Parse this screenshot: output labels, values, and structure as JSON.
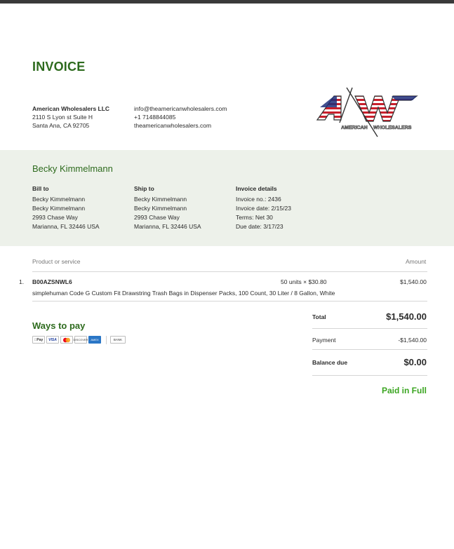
{
  "invoice": {
    "title": "INVOICE"
  },
  "company": {
    "name": "American Wholesalers LLC",
    "address_line1": "2110 S Lyon st Suite H",
    "address_line2": "Santa Ana, CA 92705",
    "email": "info@theamericanwholesalers.com",
    "phone": "+1 7148844085",
    "website": "theamericanwholesalers.com",
    "logo": {
      "letters": "AW",
      "text_left": "AMERICAN",
      "text_right": "WHOLESALERS"
    }
  },
  "customer": {
    "name": "Becky Kimmelmann",
    "bill_to": {
      "header": "Bill to",
      "lines": [
        "Becky Kimmelmann",
        "Becky Kimmelmann",
        "2993 Chase Way",
        "Marianna, FL 32446 USA"
      ]
    },
    "ship_to": {
      "header": "Ship to",
      "lines": [
        "Becky Kimmelmann",
        "Becky Kimmelmann",
        "2993 Chase Way",
        "Marianna, FL 32446 USA"
      ]
    },
    "details": {
      "header": "Invoice details",
      "lines": [
        "Invoice no.: 2436",
        "Invoice date: 2/15/23",
        "Terms: Net 30",
        "Due date: 3/17/23"
      ]
    }
  },
  "table": {
    "header_product": "Product or service",
    "header_amount": "Amount",
    "items": [
      {
        "num": "1.",
        "sku": "B00AZSNWL6",
        "qty": "50 units × $30.80",
        "amount": "$1,540.00",
        "description": "simplehuman Code G Custom Fit Drawstring Trash Bags in Dispenser Packs, 100 Count, 30 Liter / 8 Gallon, White"
      }
    ]
  },
  "payment": {
    "heading": "Ways to pay",
    "methods": [
      "Pay",
      "VISA",
      "MC",
      "DISCOVER",
      "AMEX",
      "BANK"
    ]
  },
  "summary": {
    "total_label": "Total",
    "total_value": "$1,540.00",
    "payment_label": "Payment",
    "payment_value": "-$1,540.00",
    "balance_label": "Balance due",
    "balance_value": "$0.00",
    "status": "Paid in Full"
  },
  "colors": {
    "accent": "#2e6b1e",
    "band": "#edf1ea",
    "paid": "#3aa520",
    "flag_red": "#c8202c",
    "flag_blue": "#1e2f7a"
  }
}
